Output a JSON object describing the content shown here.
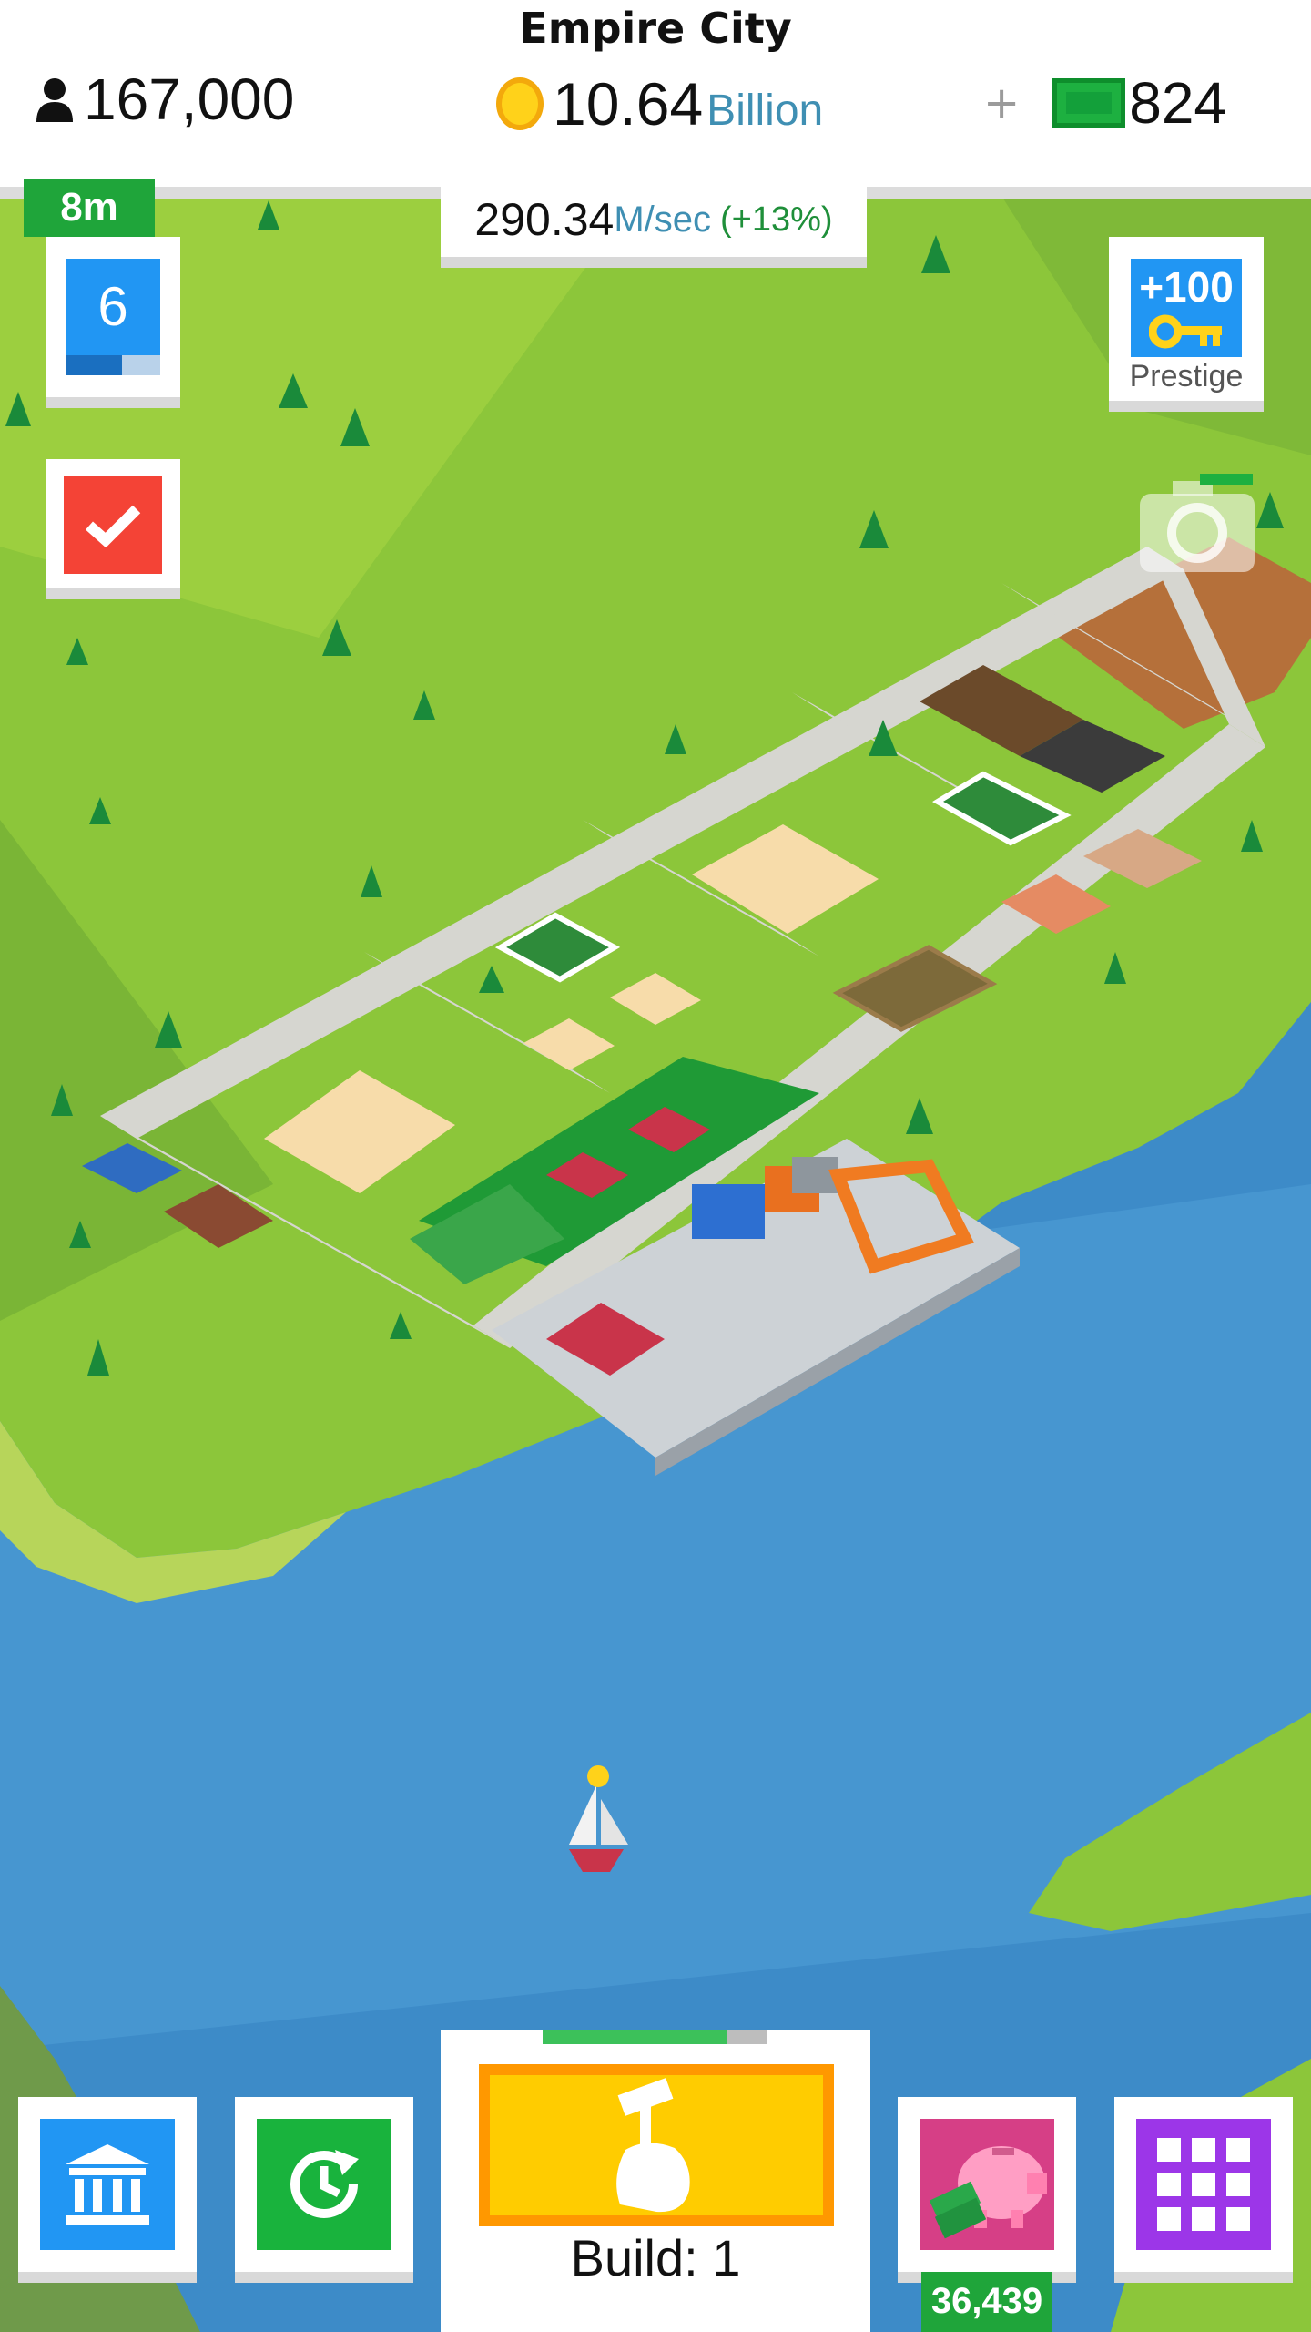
{
  "city_name": "Empire City",
  "population": "167,000",
  "money": {
    "value": "10.64",
    "unit": "Billion"
  },
  "cash": {
    "plus": "+",
    "value": "824"
  },
  "income": {
    "value": "290.34",
    "unit": "M/sec",
    "boost": "(+13%)"
  },
  "level": {
    "number": "6",
    "progress": 0.6
  },
  "prestige": {
    "bonus": "+100",
    "label": "Prestige"
  },
  "build": {
    "label": "Build: 1",
    "progress": 0.82
  },
  "timer": {
    "label": "8m"
  },
  "piggy_bank": {
    "value": "36,439"
  },
  "icons": {
    "population": "person-icon",
    "money": "coin-icon",
    "cash": "cash-bill-icon",
    "tasks": "checkmark-icon",
    "prestige": "key-icon",
    "camera": "camera-icon",
    "bank": "bank-icon",
    "timer": "clock-icon",
    "build": "hammer-hand-icon",
    "piggy": "piggy-bank-icon",
    "menu": "grid-icon"
  },
  "colors": {
    "grass": "#8cc63a",
    "water": "#3d8bc8",
    "road": "#d6d6d0",
    "accent_blue": "#2196f3",
    "build_yellow": "#ffcc00",
    "build_orange": "#ff9800",
    "green_label": "#1fa53a",
    "red_task": "#f44336",
    "purple_menu": "#9c36e8"
  }
}
